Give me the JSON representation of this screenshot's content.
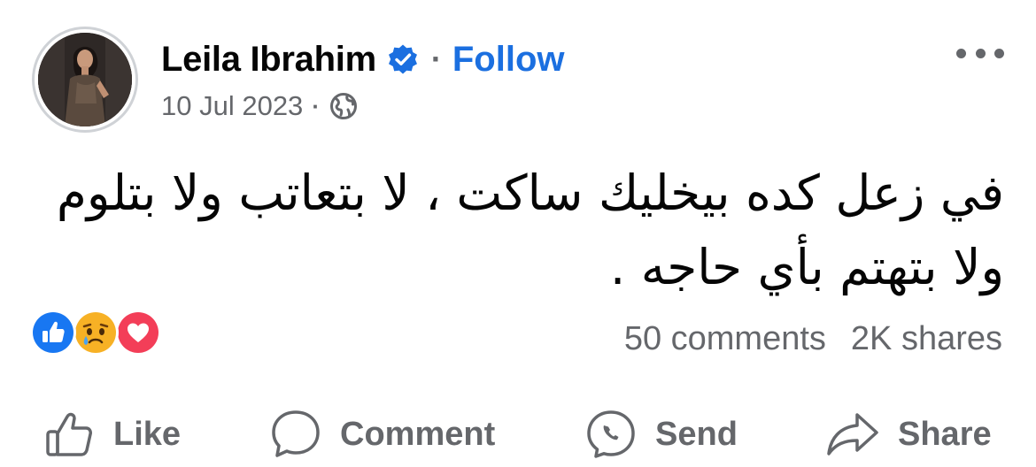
{
  "post": {
    "author": "Leila Ibrahim",
    "follow_label": "Follow",
    "separator": "·",
    "date": "10 Jul 2023",
    "meta_separator": "·",
    "text": "في زعل كده بيخليك ساكت ، لا بتعاتب ولا بتلوم ولا بتهتم بأي حاجه ."
  },
  "icons": {
    "verified": "verified-badge-icon",
    "privacy": "globe-icon",
    "more": "more-options-icon",
    "reactions": [
      "like-reaction-icon",
      "sad-reaction-icon",
      "love-reaction-icon"
    ]
  },
  "stats": {
    "comments": "50 comments",
    "shares": "2K shares"
  },
  "actions": {
    "like": "Like",
    "comment": "Comment",
    "send": "Send",
    "share": "Share"
  },
  "colors": {
    "accent": "#1b6fe0",
    "secondary_text": "#65676b",
    "text": "#050505",
    "like": "#1877f2",
    "love": "#f33e58",
    "sad": "#f7b125"
  }
}
